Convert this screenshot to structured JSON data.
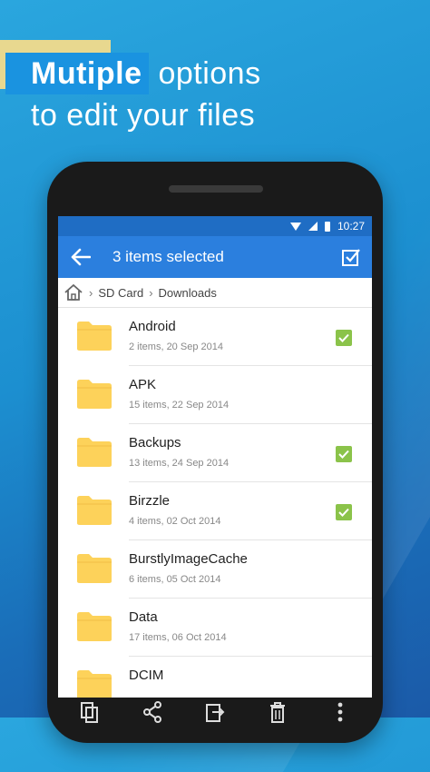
{
  "promo": {
    "headline_highlight": "Mutiple",
    "headline_rest": "options",
    "headline_line2": "to edit your files"
  },
  "status_bar": {
    "time": "10:27"
  },
  "app_bar": {
    "title": "3 items selected"
  },
  "breadcrumb": {
    "items": [
      "SD Card",
      "Downloads"
    ]
  },
  "files": [
    {
      "name": "Android",
      "meta": "2 items, 20 Sep 2014",
      "checked": true
    },
    {
      "name": "APK",
      "meta": "15 items, 22 Sep 2014",
      "checked": false
    },
    {
      "name": "Backups",
      "meta": "13 items, 24 Sep 2014",
      "checked": true
    },
    {
      "name": "Birzzle",
      "meta": "4 items, 02 Oct 2014",
      "checked": true
    },
    {
      "name": "BurstlyImageCache",
      "meta": "6 items, 05 Oct 2014",
      "checked": false
    },
    {
      "name": "Data",
      "meta": "17 items, 06 Oct 2014",
      "checked": false
    },
    {
      "name": "DCIM",
      "meta": "",
      "checked": false
    }
  ],
  "toolbar": {
    "icons": [
      "copy-icon",
      "share-icon",
      "move-icon",
      "delete-icon",
      "more-icon"
    ]
  },
  "colors": {
    "app_bar": "#2b7fde",
    "status_bar": "#1f6dc4",
    "folder": "#fdd25a",
    "check": "#8bc34a"
  }
}
